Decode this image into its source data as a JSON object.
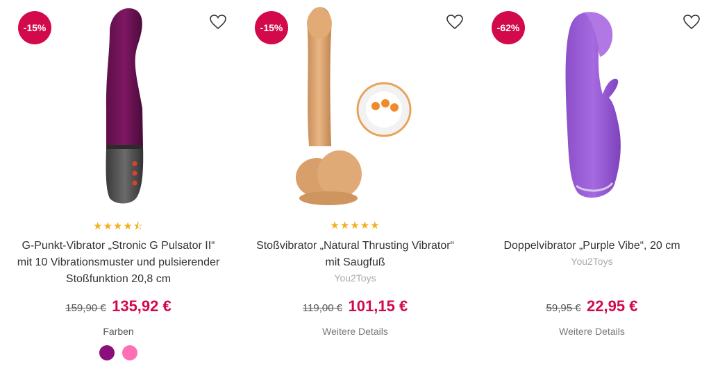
{
  "colors": {
    "accent": "#d2094a",
    "star": "#f2b01e"
  },
  "products": [
    {
      "discount": "-15%",
      "rating_stars": "★★★★⯪",
      "rating": 4.5,
      "title": "G-Punkt-Vibrator „Stronic G Pulsator II“ mit 10 Vibrationsmuster und pulsierender Stoßfunktion 20,8 cm",
      "old_price": "159,90 €",
      "price": "135,92 €",
      "colors_label": "Farben",
      "swatches": [
        "#8b0f7a",
        "#ff6fb3"
      ]
    },
    {
      "discount": "-15%",
      "rating_stars": "★★★★★",
      "rating": 5,
      "title": "Stoßvibrator „Natural Thrusting Vibrator“ mit Saugfuß",
      "brand": "You2Toys",
      "old_price": "119,00 €",
      "price": "101,15 €",
      "details": "Weitere Details"
    },
    {
      "discount": "-62%",
      "title": "Doppelvibrator „Purple Vibe“, 20 cm",
      "brand": "You2Toys",
      "old_price": "59,95 €",
      "price": "22,95 €",
      "details": "Weitere Details"
    }
  ]
}
